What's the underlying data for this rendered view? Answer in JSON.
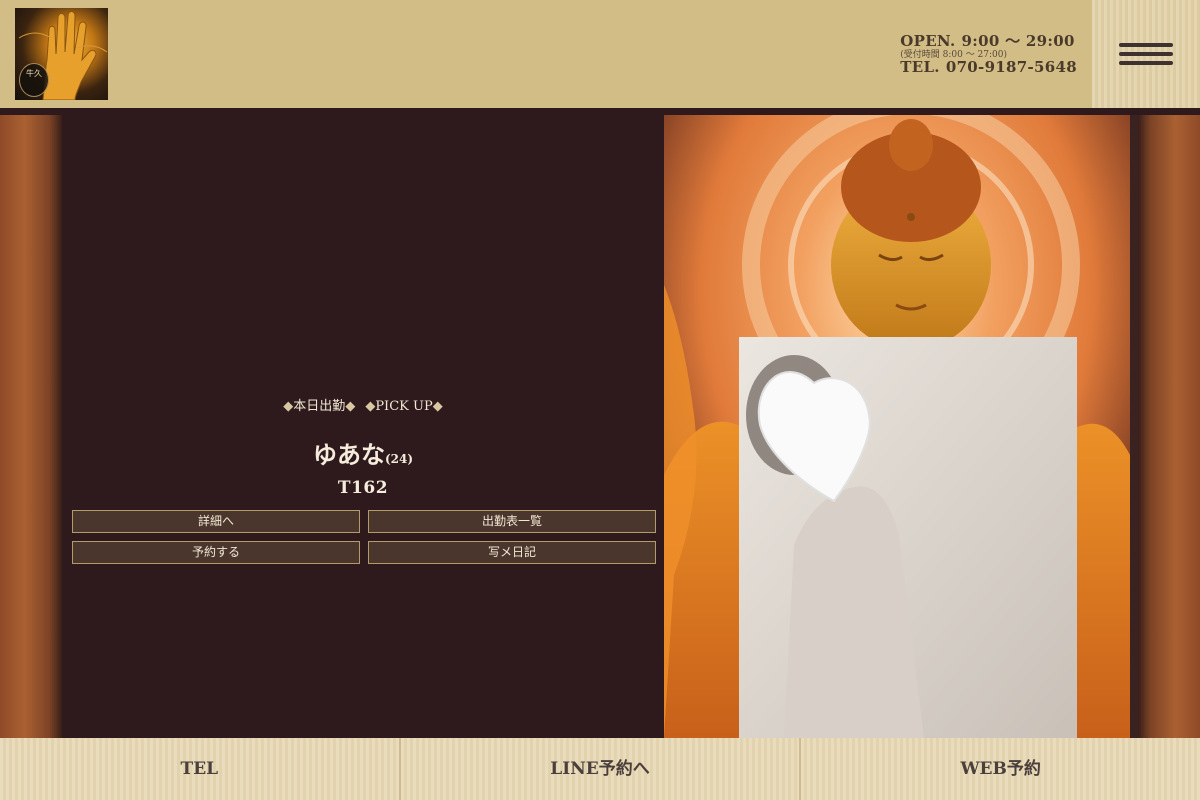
{
  "header": {
    "logo_text": "牛久",
    "open_label": "OPEN.",
    "open_hours": "9:00 ～ 29:00",
    "reception_note": "(受付時間 8:00 ～ 27:00)",
    "tel_label": "TEL.",
    "tel_number": "070-9187-5648",
    "menu_icon": "hamburger-menu-icon"
  },
  "pickup": {
    "label_1": "本日出勤",
    "label_2": "PICK UP",
    "girl_name": "ゆあな",
    "girl_age": "(24)",
    "girl_height": "T162",
    "buttons": [
      "詳細へ",
      "出勤表一覧",
      "予約する",
      "写メ日記"
    ]
  },
  "footer": {
    "tel": "TEL",
    "line": "LINE予約へ",
    "web": "WEB予約"
  },
  "colors": {
    "header_bg": "#d2bd87",
    "main_bg": "#2e1a1c",
    "button_bg": "#4a362d",
    "button_border": "#b59a6b",
    "footer_bg": "#e8dcbc"
  }
}
